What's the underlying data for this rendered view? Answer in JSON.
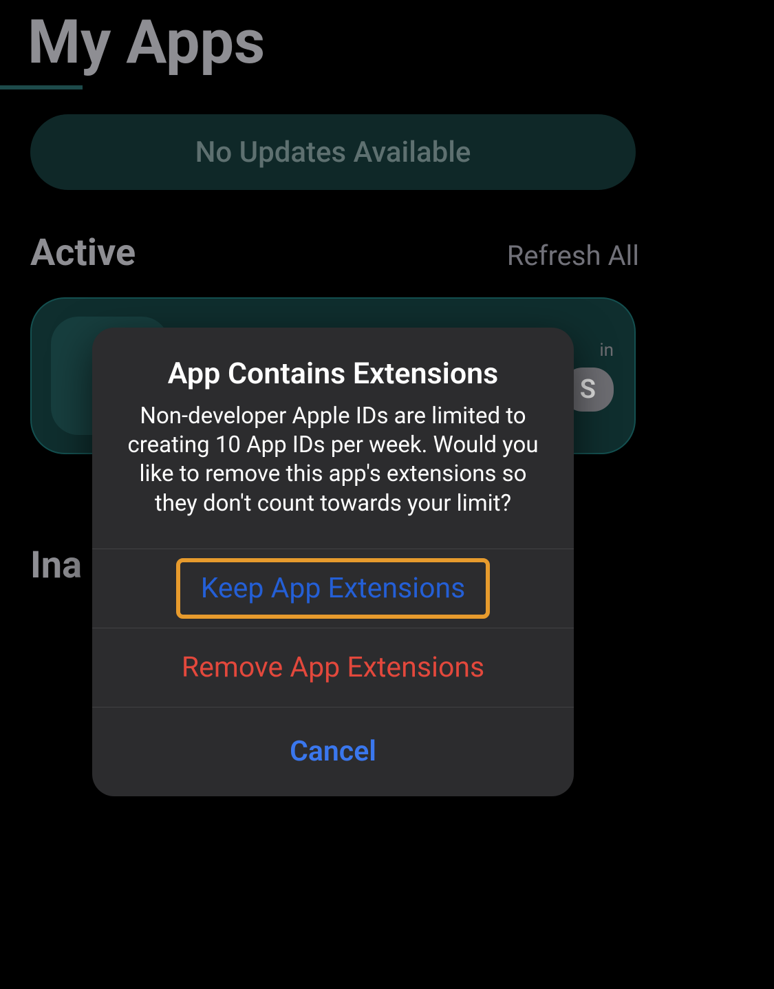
{
  "header": {
    "title": "My Apps"
  },
  "updates_banner": {
    "label": "No Updates Available"
  },
  "sections": {
    "active": {
      "heading": "Active",
      "refresh_label": "Refresh All",
      "card_badge_top": "in",
      "card_badge_main": "S"
    },
    "inactive": {
      "heading": "Ina"
    }
  },
  "dialog": {
    "title": "App Contains Extensions",
    "message": "Non-developer Apple IDs are limited to creating 10 App IDs per week. Would you like to remove this app's extensions so they don't count towards your limit?",
    "options": {
      "keep": "Keep App Extensions",
      "remove": "Remove App Extensions",
      "cancel": "Cancel"
    }
  }
}
